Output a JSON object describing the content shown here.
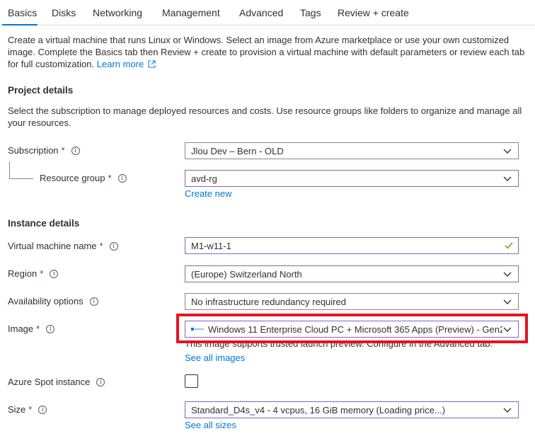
{
  "tabs": [
    "Basics",
    "Disks",
    "Networking",
    "Management",
    "Advanced",
    "Tags",
    "Review + create"
  ],
  "intro": {
    "text": "Create a virtual machine that runs Linux or Windows. Select an image from Azure marketplace or use your own customized image. Complete the Basics tab then Review + create to provision a virtual machine with default parameters or review each tab for full customization.",
    "learn_more": "Learn more"
  },
  "project": {
    "heading": "Project details",
    "description": "Select the subscription to manage deployed resources and costs. Use resource groups like folders to organize and manage all your resources.",
    "subscription_label": "Subscription",
    "subscription_value": "Jlou Dev – Bern - OLD",
    "resource_group_label": "Resource group",
    "resource_group_value": "avd-rg",
    "create_new": "Create new"
  },
  "instance": {
    "heading": "Instance details",
    "vm_name_label": "Virtual machine name",
    "vm_name_value": "M1-w11-1",
    "region_label": "Region",
    "region_value": "(Europe) Switzerland North",
    "availability_label": "Availability options",
    "availability_value": "No infrastructure redundancy required",
    "image_label": "Image",
    "image_value": "Windows 11 Enterprise Cloud PC + Microsoft 365 Apps (Preview) - Gen2",
    "image_note": "This image supports trusted launch preview. Configure in the Advanced tab.",
    "see_all_images": "See all images",
    "spot_label": "Azure Spot instance",
    "size_label": "Size",
    "size_value": "Standard_D4s_v4 - 4 vcpus, 16 GiB memory (Loading price...)",
    "see_all_sizes": "See all sizes"
  },
  "glyphs": {
    "required": "*",
    "info": "i"
  },
  "colors": {
    "accent": "#0078d4",
    "highlight": "#e81123",
    "focus": "#8764b8",
    "valid": "#57a300"
  }
}
